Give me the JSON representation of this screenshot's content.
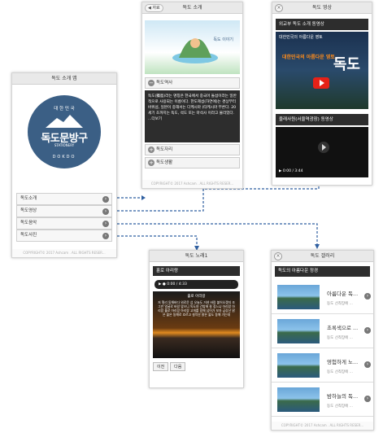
{
  "colors": {
    "accent": "#3b5f85",
    "dark": "#2d2d2d",
    "arrow": "#2f5fa0"
  },
  "app_main": {
    "title": "독도 소개 앱",
    "logo_top": "대 한 민 국",
    "logo_main": "독도문방구",
    "logo_stationery": "STATIONERY",
    "logo_bottom": "DOKDO",
    "menu": [
      "독도소개",
      "독도영상",
      "독도음악",
      "독도사진"
    ],
    "footer": "COPYRIGHT© 2017 Ashcam . ALL RIGHTS RESER..."
  },
  "app_intro": {
    "title": "독도 소개",
    "back_label": "자료",
    "banner_text": "독도 이야기",
    "sections": [
      "독도역사",
      "독도자리",
      "독도생활"
    ],
    "body_text": "독도(獨島)라는 명칭은 한국에서 중국어 돌섬이라는 일반적으로 사용되는 이름이다. 한도제섬(하연에)는 경상부터 바위섬, 일본이 중해서는 다케시마 (타케시마 부른다. 20세기 초까지는 독도, 석도 또는 마석사 이라고 불리었다. ...더보기",
    "footer": "COPYRIGHT© 2017 Ashcam . ALL RIGHTS RESER..."
  },
  "app_video": {
    "title": "독도 영상",
    "section1": "외교부 독도 소개 동영상",
    "video1_title": "대한민국의 아름다운 영토",
    "video1_overlay": "대한민국의 아름다운 영토",
    "video1_big": "독도",
    "section2": "울래사원(서울역광장) 동영상",
    "time": "0:00 / 3:44"
  },
  "app_music": {
    "title": "독도 노래1",
    "song": "홀로 아리랑",
    "time": "0:00 / 4:33",
    "lyrics_title": "홀로 아리랑",
    "lyrics": "저 멀리 동해바다 외로운 섬 오늘도 거센 바람 불어오겠지 조그만 얼굴로 바람 맞으니 독도야 간밤에 잘 잤느냐 아리랑 아리랑 홀로 아리랑 아리랑 고개를 함께 넘어가 보자 금강산 맑은 물은 동해로 흐르고 설악산 맑은 물도 동해 가는데",
    "prev": "이전",
    "next": "다음"
  },
  "app_gallery": {
    "title": "독도 갤러리",
    "section": "독도의 아름다운 정경",
    "items": [
      {
        "title": "아름다운 독...",
        "sub": "동도 선착장에 ..."
      },
      {
        "title": "초록색으로 ...",
        "sub": "동도 선착장에 ..."
      },
      {
        "title": "영험하게 노...",
        "sub": "동도 선착장에 ..."
      },
      {
        "title": "밤하늘의 독...",
        "sub": "동도 선착장에 ..."
      }
    ],
    "footer": "COPYRIGHT© 2017 Ashcam . ALL RIGHTS RESER..."
  }
}
